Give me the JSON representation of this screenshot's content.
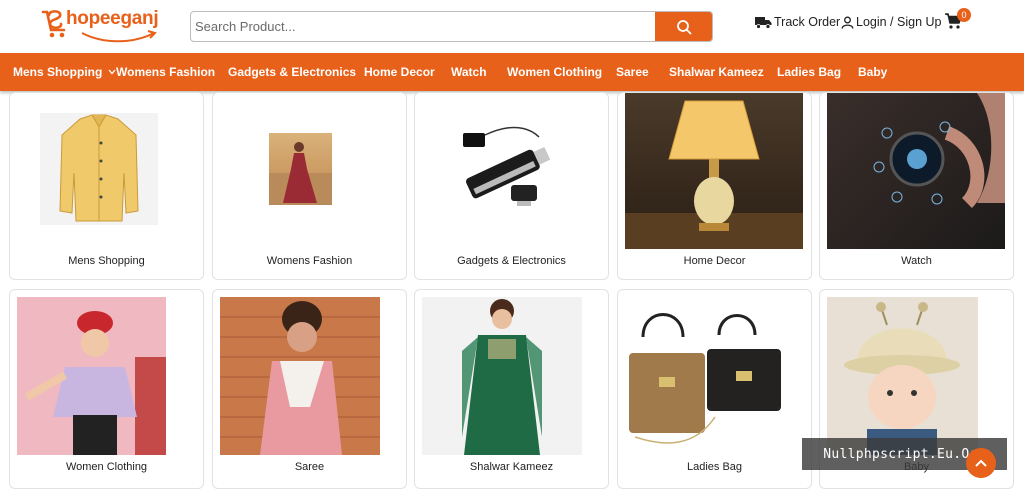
{
  "header": {
    "logo_text": "hopeeganj",
    "search_placeholder": "Search Product...",
    "track_order": "Track Order",
    "login": "Login / Sign Up",
    "cart_count": "0"
  },
  "nav": {
    "items": [
      {
        "label": "Mens Shopping",
        "has_dropdown": true
      },
      {
        "label": "Womens Fashion"
      },
      {
        "label": "Gadgets & Electronics"
      },
      {
        "label": "Home Decor"
      },
      {
        "label": "Watch"
      },
      {
        "label": "Women Clothing"
      },
      {
        "label": "Saree"
      },
      {
        "label": "Shalwar Kameez"
      },
      {
        "label": "Ladies Bag"
      },
      {
        "label": "Baby"
      }
    ]
  },
  "categories": [
    {
      "label": "Mens Shopping",
      "image": "mens-shirt"
    },
    {
      "label": "Womens Fashion",
      "image": "womens-lehenga"
    },
    {
      "label": "Gadgets & Electronics",
      "image": "usb-drive"
    },
    {
      "label": "Home Decor",
      "image": "table-lamp"
    },
    {
      "label": "Watch",
      "image": "smart-watch"
    },
    {
      "label": "Women Clothing",
      "image": "woman-outfit"
    },
    {
      "label": "Saree",
      "image": "woman-saree"
    },
    {
      "label": "Shalwar Kameez",
      "image": "green-kameez"
    },
    {
      "label": "Ladies Bag",
      "image": "handbags"
    },
    {
      "label": "Baby",
      "image": "baby-hat"
    }
  ],
  "watermark": "Nullphpscript.Eu.Org",
  "colors": {
    "accent": "#e8611a",
    "logo_green": "#2a7a3b"
  }
}
